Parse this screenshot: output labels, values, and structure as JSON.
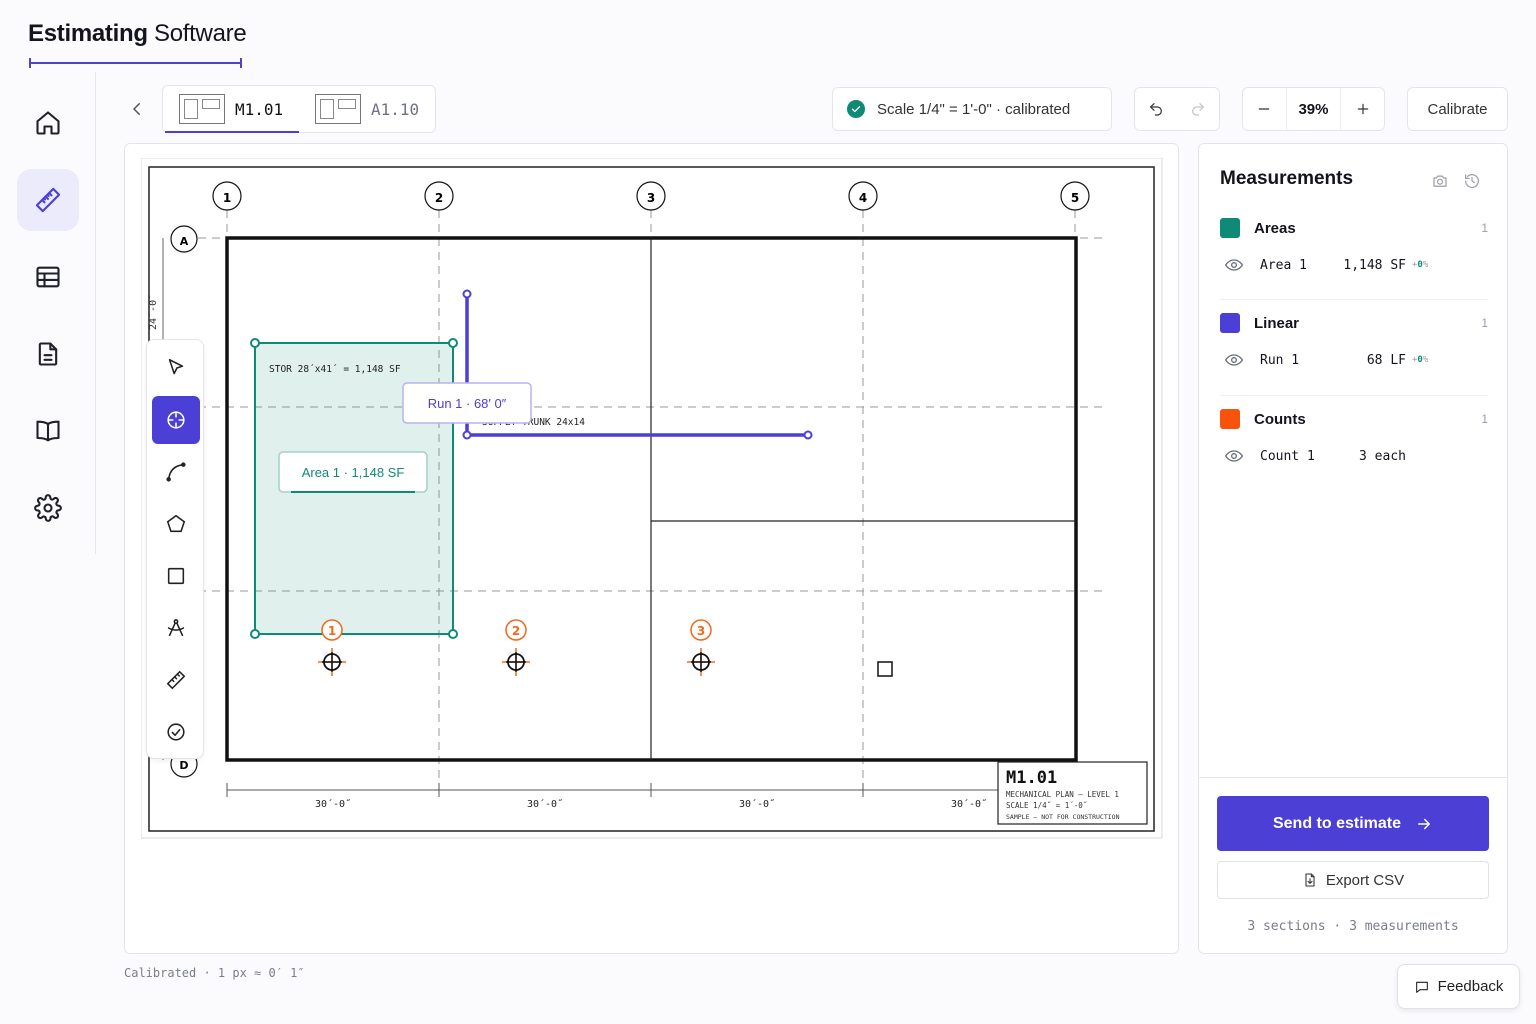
{
  "app": {
    "title_bold": "Estimating",
    "title_rest": " Software"
  },
  "nav": {
    "items": [
      {
        "icon": "home-icon"
      },
      {
        "icon": "ruler-icon",
        "active": true
      },
      {
        "icon": "table-icon"
      },
      {
        "icon": "document-icon"
      },
      {
        "icon": "book-icon"
      },
      {
        "icon": "gear-icon"
      }
    ]
  },
  "sheets": {
    "tabs": [
      {
        "label": "M1.01",
        "active": true
      },
      {
        "label": "A1.10",
        "active": false
      }
    ]
  },
  "scale": {
    "text": "Scale 1/4\" = 1'-0\" · calibrated"
  },
  "zoom": {
    "value": "39%"
  },
  "calibrate_label": "Calibrate",
  "drawing": {
    "grid_cols": [
      "1",
      "2",
      "3",
      "4",
      "5"
    ],
    "grid_rows": [
      "A",
      "D"
    ],
    "dims": [
      "30´-0˝",
      "30´-0˝",
      "30´-0˝",
      "30´-0˝"
    ],
    "side_dim": "24´-0˝",
    "room_label": "STOR 28´x41´ = 1,148 SF",
    "duct_label": "SUPPLY TRUNK 24x14",
    "area_tag": "Area 1 · 1,148 SF",
    "run_tag": "Run 1 · 68′ 0″",
    "count_markers": [
      "1",
      "2",
      "3"
    ],
    "title_block": {
      "sheet": "M1.01",
      "line1": "MECHANICAL PLAN — LEVEL 1",
      "line2": "SCALE 1/4˝ = 1´-0˝",
      "line3": "SAMPLE — NOT FOR CONSTRUCTION"
    },
    "colors": {
      "area": "#0f8a76",
      "linear": "#4c3fd6",
      "count": "#f06a1d"
    }
  },
  "tools": [
    {
      "icon": "pointer-icon"
    },
    {
      "icon": "crosshair-icon",
      "active": true
    },
    {
      "icon": "curve-icon"
    },
    {
      "icon": "polygon-icon"
    },
    {
      "icon": "rectangle-icon"
    },
    {
      "icon": "compass-icon"
    },
    {
      "icon": "ruler-icon"
    },
    {
      "icon": "check-circle-icon"
    }
  ],
  "footnote": "Calibrated · 1 px ≈ 0′ 1″",
  "panel": {
    "title": "Measurements",
    "sections": [
      {
        "name": "Areas",
        "color": "#0f8a76",
        "count": "1",
        "rows": [
          {
            "name": "Area 1",
            "value": "1,148 SF",
            "delta_sign": "+",
            "delta_val": "0",
            "delta_unit": "%"
          }
        ]
      },
      {
        "name": "Linear",
        "color": "#4c3fd6",
        "count": "1",
        "rows": [
          {
            "name": "Run 1",
            "value": "68 LF",
            "delta_sign": "+",
            "delta_val": "0",
            "delta_unit": "%"
          }
        ]
      },
      {
        "name": "Counts",
        "color": "#f9520b",
        "count": "1",
        "rows": [
          {
            "name": "Count 1",
            "value": "3 each"
          }
        ]
      }
    ],
    "send_label": "Send to estimate",
    "export_label": "Export CSV",
    "summary": "3 sections · 3 measurements"
  },
  "feedback_label": "Feedback"
}
